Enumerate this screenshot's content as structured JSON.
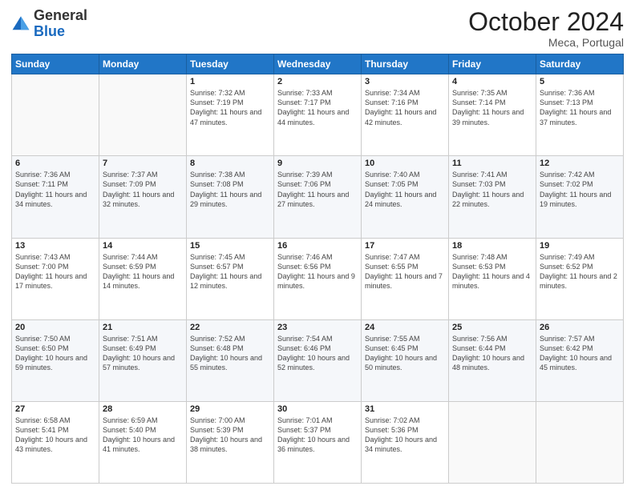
{
  "logo": {
    "general": "General",
    "blue": "Blue"
  },
  "header": {
    "month": "October 2024",
    "location": "Meca, Portugal"
  },
  "weekdays": [
    "Sunday",
    "Monday",
    "Tuesday",
    "Wednesday",
    "Thursday",
    "Friday",
    "Saturday"
  ],
  "weeks": [
    [
      {
        "day": "",
        "info": ""
      },
      {
        "day": "",
        "info": ""
      },
      {
        "day": "1",
        "info": "Sunrise: 7:32 AM\nSunset: 7:19 PM\nDaylight: 11 hours and 47 minutes."
      },
      {
        "day": "2",
        "info": "Sunrise: 7:33 AM\nSunset: 7:17 PM\nDaylight: 11 hours and 44 minutes."
      },
      {
        "day": "3",
        "info": "Sunrise: 7:34 AM\nSunset: 7:16 PM\nDaylight: 11 hours and 42 minutes."
      },
      {
        "day": "4",
        "info": "Sunrise: 7:35 AM\nSunset: 7:14 PM\nDaylight: 11 hours and 39 minutes."
      },
      {
        "day": "5",
        "info": "Sunrise: 7:36 AM\nSunset: 7:13 PM\nDaylight: 11 hours and 37 minutes."
      }
    ],
    [
      {
        "day": "6",
        "info": "Sunrise: 7:36 AM\nSunset: 7:11 PM\nDaylight: 11 hours and 34 minutes."
      },
      {
        "day": "7",
        "info": "Sunrise: 7:37 AM\nSunset: 7:09 PM\nDaylight: 11 hours and 32 minutes."
      },
      {
        "day": "8",
        "info": "Sunrise: 7:38 AM\nSunset: 7:08 PM\nDaylight: 11 hours and 29 minutes."
      },
      {
        "day": "9",
        "info": "Sunrise: 7:39 AM\nSunset: 7:06 PM\nDaylight: 11 hours and 27 minutes."
      },
      {
        "day": "10",
        "info": "Sunrise: 7:40 AM\nSunset: 7:05 PM\nDaylight: 11 hours and 24 minutes."
      },
      {
        "day": "11",
        "info": "Sunrise: 7:41 AM\nSunset: 7:03 PM\nDaylight: 11 hours and 22 minutes."
      },
      {
        "day": "12",
        "info": "Sunrise: 7:42 AM\nSunset: 7:02 PM\nDaylight: 11 hours and 19 minutes."
      }
    ],
    [
      {
        "day": "13",
        "info": "Sunrise: 7:43 AM\nSunset: 7:00 PM\nDaylight: 11 hours and 17 minutes."
      },
      {
        "day": "14",
        "info": "Sunrise: 7:44 AM\nSunset: 6:59 PM\nDaylight: 11 hours and 14 minutes."
      },
      {
        "day": "15",
        "info": "Sunrise: 7:45 AM\nSunset: 6:57 PM\nDaylight: 11 hours and 12 minutes."
      },
      {
        "day": "16",
        "info": "Sunrise: 7:46 AM\nSunset: 6:56 PM\nDaylight: 11 hours and 9 minutes."
      },
      {
        "day": "17",
        "info": "Sunrise: 7:47 AM\nSunset: 6:55 PM\nDaylight: 11 hours and 7 minutes."
      },
      {
        "day": "18",
        "info": "Sunrise: 7:48 AM\nSunset: 6:53 PM\nDaylight: 11 hours and 4 minutes."
      },
      {
        "day": "19",
        "info": "Sunrise: 7:49 AM\nSunset: 6:52 PM\nDaylight: 11 hours and 2 minutes."
      }
    ],
    [
      {
        "day": "20",
        "info": "Sunrise: 7:50 AM\nSunset: 6:50 PM\nDaylight: 10 hours and 59 minutes."
      },
      {
        "day": "21",
        "info": "Sunrise: 7:51 AM\nSunset: 6:49 PM\nDaylight: 10 hours and 57 minutes."
      },
      {
        "day": "22",
        "info": "Sunrise: 7:52 AM\nSunset: 6:48 PM\nDaylight: 10 hours and 55 minutes."
      },
      {
        "day": "23",
        "info": "Sunrise: 7:54 AM\nSunset: 6:46 PM\nDaylight: 10 hours and 52 minutes."
      },
      {
        "day": "24",
        "info": "Sunrise: 7:55 AM\nSunset: 6:45 PM\nDaylight: 10 hours and 50 minutes."
      },
      {
        "day": "25",
        "info": "Sunrise: 7:56 AM\nSunset: 6:44 PM\nDaylight: 10 hours and 48 minutes."
      },
      {
        "day": "26",
        "info": "Sunrise: 7:57 AM\nSunset: 6:42 PM\nDaylight: 10 hours and 45 minutes."
      }
    ],
    [
      {
        "day": "27",
        "info": "Sunrise: 6:58 AM\nSunset: 5:41 PM\nDaylight: 10 hours and 43 minutes."
      },
      {
        "day": "28",
        "info": "Sunrise: 6:59 AM\nSunset: 5:40 PM\nDaylight: 10 hours and 41 minutes."
      },
      {
        "day": "29",
        "info": "Sunrise: 7:00 AM\nSunset: 5:39 PM\nDaylight: 10 hours and 38 minutes."
      },
      {
        "day": "30",
        "info": "Sunrise: 7:01 AM\nSunset: 5:37 PM\nDaylight: 10 hours and 36 minutes."
      },
      {
        "day": "31",
        "info": "Sunrise: 7:02 AM\nSunset: 5:36 PM\nDaylight: 10 hours and 34 minutes."
      },
      {
        "day": "",
        "info": ""
      },
      {
        "day": "",
        "info": ""
      }
    ]
  ]
}
